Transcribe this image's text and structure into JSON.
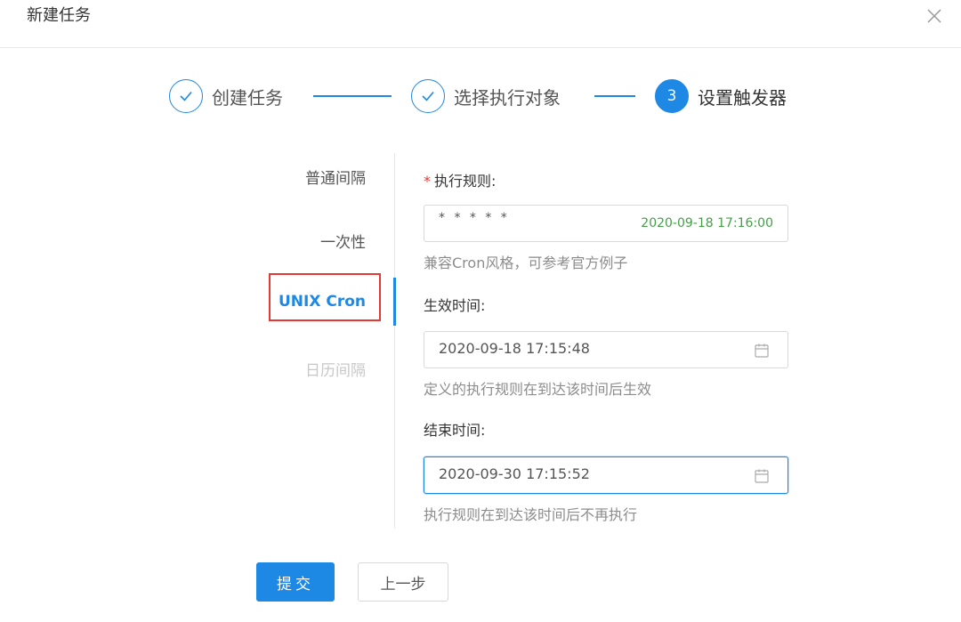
{
  "dialog": {
    "title": "新建任务"
  },
  "steps": [
    {
      "label": "创建任务",
      "status": "done"
    },
    {
      "label": "选择执行对象",
      "status": "done"
    },
    {
      "label": "设置触发器",
      "status": "active",
      "number": "3"
    }
  ],
  "side_tabs": [
    {
      "label": "普通间隔"
    },
    {
      "label": "一次性"
    },
    {
      "label": "UNIX Cron",
      "active": true
    },
    {
      "label": "日历间隔",
      "disabled": true
    }
  ],
  "form": {
    "rule": {
      "label": "执行规则:",
      "required_mark": "*",
      "value": "* * * * *",
      "next_run": "2020-09-18 17:16:00",
      "help": "兼容Cron风格，可参考官方例子"
    },
    "start": {
      "label": "生效时间:",
      "value": "2020-09-18 17:15:48",
      "help": "定义的执行规则在到达该时间后生效"
    },
    "end": {
      "label": "结束时间:",
      "value": "2020-09-30 17:15:52",
      "help": "执行规则在到达该时间后不再执行"
    }
  },
  "buttons": {
    "submit": "提交",
    "prev": "上一步"
  },
  "colors": {
    "primary": "#1e88e5",
    "success": "#43a047",
    "danger": "#e53935"
  }
}
